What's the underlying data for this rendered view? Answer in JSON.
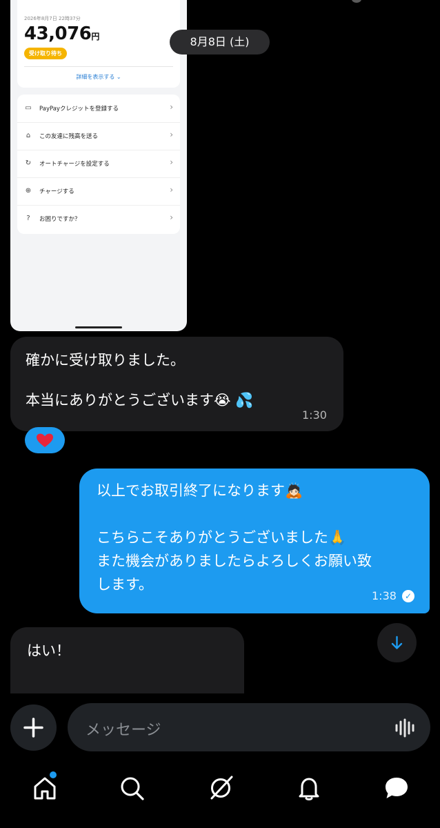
{
  "embedded_screenshot": {
    "timestamp": "2026年8月7日 22時37分",
    "amount": "43,076",
    "currency": "円",
    "status_badge": "受け取り待ち",
    "details_link": "詳細を表示する",
    "menu": [
      {
        "label": "PayPayクレジットを登録する",
        "icon": "card-icon"
      },
      {
        "label": "この友達に残高を送る",
        "icon": "house-send-icon"
      },
      {
        "label": "オートチャージを設定する",
        "icon": "auto-charge-icon"
      },
      {
        "label": "チャージする",
        "icon": "plus-circle-icon"
      },
      {
        "label": "お困りですか？",
        "icon": "help-icon"
      }
    ]
  },
  "date_separator": "8月8日 (土)",
  "messages": [
    {
      "direction": "incoming",
      "lines": [
        "確かに受け取りました。",
        "本当にありがとうございます😭 💦"
      ],
      "time": "1:30",
      "reaction": "❤️"
    },
    {
      "direction": "outgoing",
      "lines": [
        "以上でお取引終了になります🙇🏻",
        "こちらこそありがとうございました🙏",
        "また機会がありましたらよろしくお願い致",
        "します。"
      ],
      "time": "1:38"
    },
    {
      "direction": "incoming",
      "lines": [
        "はい！"
      ]
    }
  ],
  "composer": {
    "placeholder": "メッセージ"
  },
  "nav": [
    "home-icon",
    "search-icon",
    "grok-icon",
    "notifications-icon",
    "messages-icon"
  ],
  "colors": {
    "accent": "#1d9bf0",
    "bubble_incoming": "#1c1c1e",
    "background": "#000000"
  }
}
